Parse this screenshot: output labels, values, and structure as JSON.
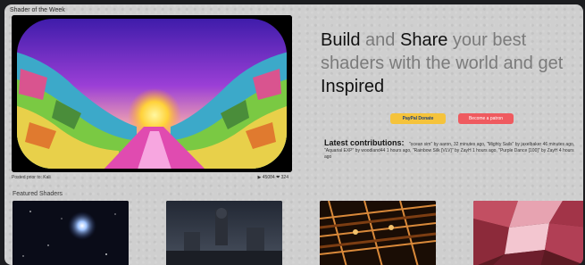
{
  "header": {
    "section_label": "Shader of the Week"
  },
  "featured_video": {
    "author_line": "Posted prior to: Kali",
    "stats": "▶ 45084 ❤ 324"
  },
  "hero": {
    "w1": "Build",
    "w2": "and",
    "w3": "Share",
    "w4": "your best shaders with the world and get",
    "w5": "Inspired"
  },
  "buttons": {
    "paypal": "PayPal Donate",
    "patreon": "Become a patron"
  },
  "latest": {
    "title": "Latest contributions:",
    "text": "\"ocean sim\" by aaron, 32 minutes ago, \"Mighty Sails\" by jaxelbaker 46 minutes ago, \"Aquarial EXP\" by woodland44 1 hours ago, \"Rainbow Silk [VLV]\" by ZayH 1 hours ago, \"Purple Dance [100]\" by ZayH 4 hours ago"
  },
  "featured": {
    "label": "Featured Shaders"
  },
  "colors": {
    "panel_bg": "#cfcfcf",
    "page_bg": "#1c1d20",
    "paypal": "#f5c33b",
    "patreon": "#ef5a5f"
  }
}
